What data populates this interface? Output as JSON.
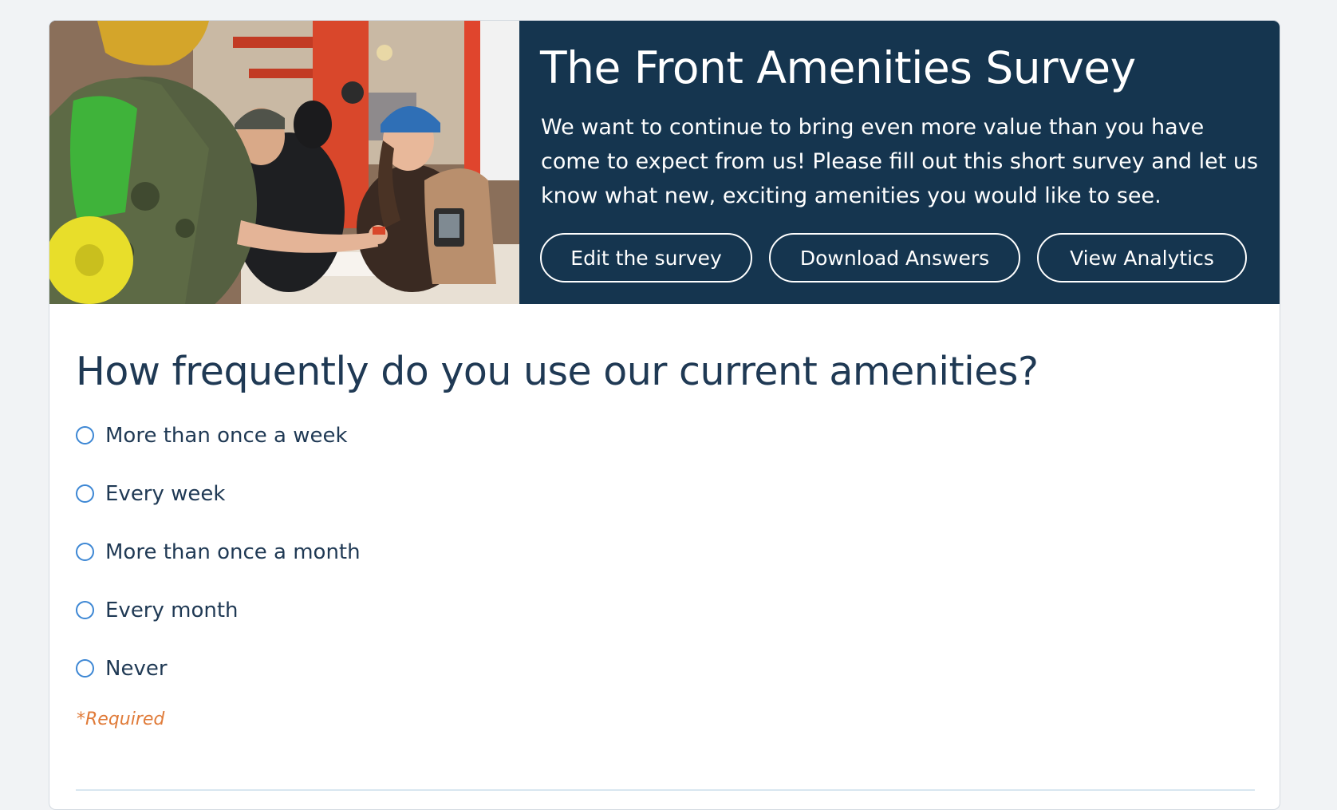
{
  "banner": {
    "title": "The Front Amenities Survey",
    "description": "We want to continue to bring even more value than you have come to expect from us! Please fill out this short survey and let us know what new, exciting amenities you would like to see.",
    "buttons": {
      "edit": "Edit the survey",
      "download": "Download Answers",
      "analytics": "View Analytics"
    }
  },
  "question": {
    "title": "How frequently do you use our current amenities?",
    "options": [
      "More than once a week",
      "Every week",
      "More than once a month",
      "Every month",
      "Never"
    ],
    "selected": null,
    "required_label": "*Required"
  },
  "colors": {
    "banner_background": "#15354f",
    "question_text": "#1f3954",
    "radio_border": "#3d87d4",
    "required_text": "#e07b39",
    "page_background": "#f1f3f5"
  }
}
